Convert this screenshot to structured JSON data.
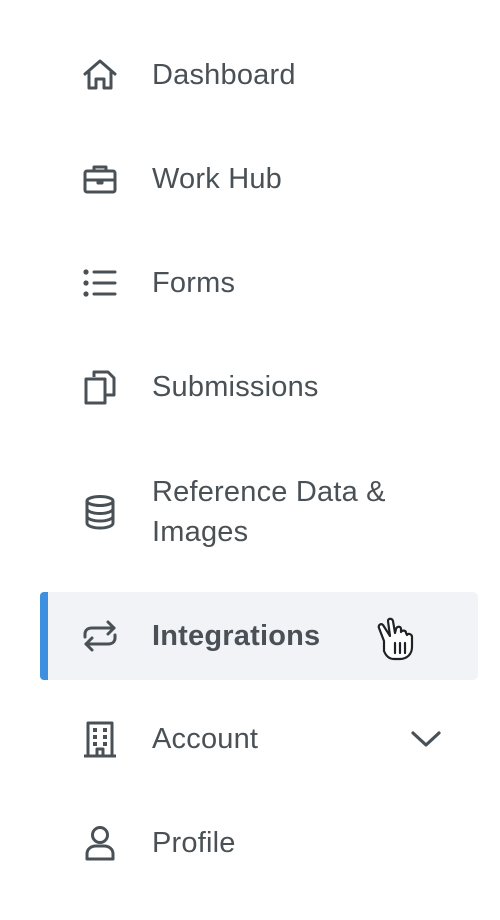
{
  "nav": {
    "items": [
      {
        "label": "Dashboard",
        "icon": "home-icon"
      },
      {
        "label": "Work Hub",
        "icon": "briefcase-icon"
      },
      {
        "label": "Forms",
        "icon": "list-icon"
      },
      {
        "label": "Submissions",
        "icon": "copy-icon"
      },
      {
        "label": "Reference Data & Images",
        "label_line1": "Reference Data &",
        "label_line2": "Images",
        "icon": "database-icon"
      },
      {
        "label": "Integrations",
        "icon": "sync-arrows-icon",
        "active": true
      },
      {
        "label": "Account",
        "icon": "building-icon",
        "expandable": true
      },
      {
        "label": "Profile",
        "icon": "user-icon"
      }
    ]
  },
  "colors": {
    "active_background": "#f1f3f7",
    "active_indicator": "#3d8fe0",
    "text": "#4a5156"
  }
}
